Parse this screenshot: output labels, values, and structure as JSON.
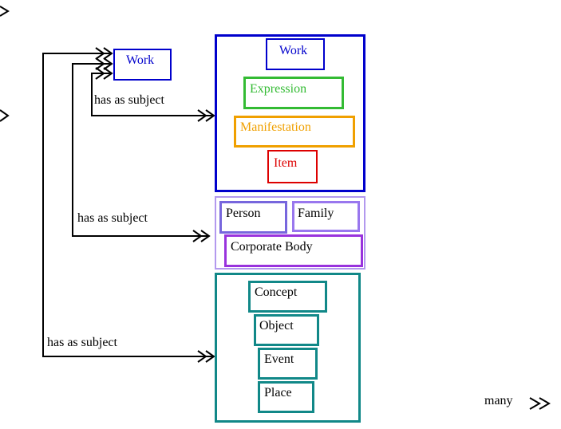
{
  "diagram": {
    "source_node": {
      "label": "Work",
      "color": "#0000cc"
    },
    "edge_label": "has as subject",
    "group1": {
      "border_color": "#0000cc",
      "entities": [
        {
          "label": "Work",
          "color": "#0000cc"
        },
        {
          "label": "Expression",
          "color": "#33bb33"
        },
        {
          "label": "Manifestation",
          "color": "#f0a000"
        },
        {
          "label": "Item",
          "color": "#dd0000"
        }
      ]
    },
    "group2": {
      "border_color": "#b399ee",
      "entities": [
        {
          "label": "Person",
          "color": "#7766dd"
        },
        {
          "label": "Family",
          "color": "#9977ee"
        },
        {
          "label": "Corporate Body",
          "color": "#9933dd"
        }
      ]
    },
    "group3": {
      "border_color": "#118888",
      "entities": [
        {
          "label": "Concept",
          "color": "#118888"
        },
        {
          "label": "Object",
          "color": "#118888"
        },
        {
          "label": "Event",
          "color": "#118888"
        },
        {
          "label": "Place",
          "color": "#118888"
        }
      ]
    },
    "legend": {
      "label": "many"
    }
  }
}
